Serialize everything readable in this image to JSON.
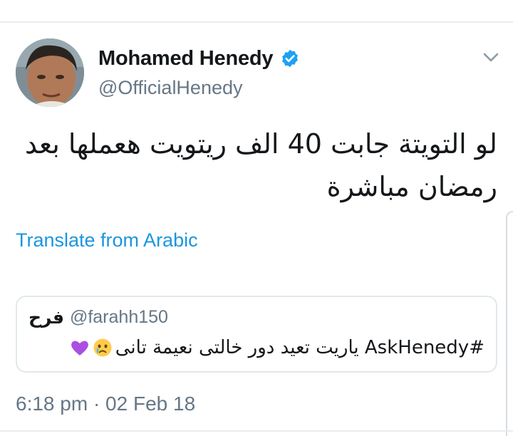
{
  "tweet": {
    "author": {
      "display_name": "Mohamed Henedy",
      "handle": "@OfficialHenedy",
      "verified": true,
      "verified_color": "#1da1f2"
    },
    "text": "لو التويتة جابت 40 الف ريتويت هعملها بعد رمضان مباشرة",
    "translate_label": "Translate from Arabic",
    "quoted": {
      "display_name": "فرح",
      "handle": "@farahh150",
      "text": "#AskHenedy ياريت تعيد دور خالتى نعيمة تانى",
      "emojis": [
        "crying-face-emoji",
        "purple-heart-emoji"
      ]
    },
    "timestamp": "6:18 pm · 02 Feb 18"
  },
  "icons": {
    "more_menu": "chevron-down-icon",
    "verified": "verified-badge-icon"
  },
  "colors": {
    "link": "#1b95e0",
    "secondary_text": "#657786",
    "primary_text": "#14171a",
    "border": "#e1e8ed"
  }
}
